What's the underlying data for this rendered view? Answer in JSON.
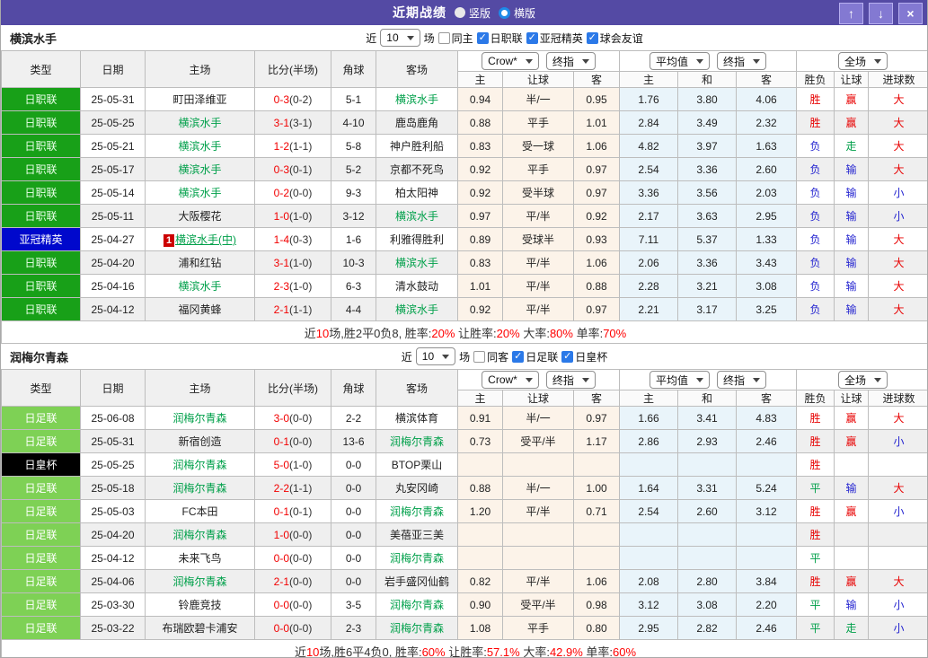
{
  "titlebar": {
    "title": "近期战绩",
    "radio_vertical": "竖版",
    "radio_horizontal": "横版",
    "up_icon": "↑",
    "down_icon": "↓",
    "close_icon": "×"
  },
  "colors": {
    "titlebar_purple": "#544aa4",
    "badge_green": "#18a018",
    "badge_lightgreen": "#7ed155",
    "badge_blue": "#0008cc",
    "badge_black": "#000000",
    "team_green": "#00a04a",
    "score_red": "#f20000",
    "win_red": "#e80000",
    "draw_green": "#00a04a",
    "lose_blue": "#2424d0",
    "handicap_odds_bg": "#fcf3e9",
    "average_odds_bg": "#e9f4fa",
    "checkbox_blue": "#2b79e8"
  },
  "sections": [
    {
      "team": "横滨水手",
      "filter": {
        "near_label": "近",
        "games_value": "10",
        "games_label": "场",
        "checkboxes": [
          {
            "label": "同主",
            "checked": false
          },
          {
            "label": "日职联",
            "checked": true
          },
          {
            "label": "亚冠精英",
            "checked": true
          },
          {
            "label": "球会友谊",
            "checked": true
          }
        ]
      },
      "header": {
        "cols": [
          "类型",
          "日期",
          "主场",
          "比分(半场)",
          "角球",
          "客场"
        ],
        "dropdowns": [
          "Crow*",
          "终指",
          "平均值",
          "终指",
          "全场"
        ],
        "sub_cols": [
          "主",
          "让球",
          "客",
          "主",
          "和",
          "客",
          "胜负",
          "让球",
          "进球数"
        ]
      },
      "rows": [
        {
          "type": "日职联",
          "badge": "green",
          "date": "25-05-31",
          "home": "町田泽维亚",
          "homeTeam": false,
          "score": "0-3",
          "half": "0-2",
          "corner": "5-1",
          "away": "横滨水手",
          "awayTeam": true,
          "odds": [
            "0.94",
            "半/一",
            "0.95",
            "1.76",
            "3.80",
            "4.06"
          ],
          "res": [
            "胜",
            "赢",
            "大"
          ]
        },
        {
          "type": "日职联",
          "badge": "green",
          "date": "25-05-25",
          "home": "横滨水手",
          "homeTeam": true,
          "score": "3-1",
          "half": "3-1",
          "corner": "4-10",
          "away": "鹿岛鹿角",
          "awayTeam": false,
          "odds": [
            "0.88",
            "平手",
            "1.01",
            "2.84",
            "3.49",
            "2.32"
          ],
          "res": [
            "胜",
            "赢",
            "大"
          ]
        },
        {
          "type": "日职联",
          "badge": "green",
          "date": "25-05-21",
          "home": "横滨水手",
          "homeTeam": true,
          "score": "1-2",
          "half": "1-1",
          "corner": "5-8",
          "away": "神户胜利船",
          "awayTeam": false,
          "odds": [
            "0.83",
            "受一球",
            "1.06",
            "4.82",
            "3.97",
            "1.63"
          ],
          "res": [
            "负",
            "走",
            "大"
          ]
        },
        {
          "type": "日职联",
          "badge": "green",
          "date": "25-05-17",
          "home": "横滨水手",
          "homeTeam": true,
          "score": "0-3",
          "half": "0-1",
          "corner": "5-2",
          "away": "京都不死鸟",
          "awayTeam": false,
          "odds": [
            "0.92",
            "平手",
            "0.97",
            "2.54",
            "3.36",
            "2.60"
          ],
          "res": [
            "负",
            "输",
            "大"
          ]
        },
        {
          "type": "日职联",
          "badge": "green",
          "date": "25-05-14",
          "home": "横滨水手",
          "homeTeam": true,
          "score": "0-2",
          "half": "0-0",
          "corner": "9-3",
          "away": "柏太阳神",
          "awayTeam": false,
          "odds": [
            "0.92",
            "受半球",
            "0.97",
            "3.36",
            "3.56",
            "2.03"
          ],
          "res": [
            "负",
            "输",
            "小"
          ]
        },
        {
          "type": "日职联",
          "badge": "green",
          "date": "25-05-11",
          "home": "大阪樱花",
          "homeTeam": false,
          "score": "1-0",
          "half": "1-0",
          "corner": "3-12",
          "away": "横滨水手",
          "awayTeam": true,
          "odds": [
            "0.97",
            "平/半",
            "0.92",
            "2.17",
            "3.63",
            "2.95"
          ],
          "res": [
            "负",
            "输",
            "小"
          ]
        },
        {
          "type": "亚冠精英",
          "badge": "blue",
          "date": "25-04-27",
          "home": "横滨水手(中)",
          "homeTeam": true,
          "mark": "1",
          "score": "1-4",
          "half": "0-3",
          "corner": "1-6",
          "away": "利雅得胜利",
          "awayTeam": false,
          "odds": [
            "0.89",
            "受球半",
            "0.93",
            "7.11",
            "5.37",
            "1.33"
          ],
          "res": [
            "负",
            "输",
            "大"
          ]
        },
        {
          "type": "日职联",
          "badge": "green",
          "date": "25-04-20",
          "home": "浦和红钻",
          "homeTeam": false,
          "score": "3-1",
          "half": "1-0",
          "corner": "10-3",
          "away": "横滨水手",
          "awayTeam": true,
          "odds": [
            "0.83",
            "平/半",
            "1.06",
            "2.06",
            "3.36",
            "3.43"
          ],
          "res": [
            "负",
            "输",
            "大"
          ]
        },
        {
          "type": "日职联",
          "badge": "green",
          "date": "25-04-16",
          "home": "横滨水手",
          "homeTeam": true,
          "score": "2-3",
          "half": "1-0",
          "corner": "6-3",
          "away": "清水鼓动",
          "awayTeam": false,
          "odds": [
            "1.01",
            "平/半",
            "0.88",
            "2.28",
            "3.21",
            "3.08"
          ],
          "res": [
            "负",
            "输",
            "大"
          ]
        },
        {
          "type": "日职联",
          "badge": "green",
          "date": "25-04-12",
          "home": "福冈黄蜂",
          "homeTeam": false,
          "score": "2-1",
          "half": "1-1",
          "corner": "4-4",
          "away": "横滨水手",
          "awayTeam": true,
          "odds": [
            "0.92",
            "平/半",
            "0.97",
            "2.21",
            "3.17",
            "3.25"
          ],
          "res": [
            "负",
            "输",
            "大"
          ]
        }
      ],
      "summary": [
        {
          "text": "近",
          "red": false
        },
        {
          "text": "10",
          "red": true
        },
        {
          "text": "场,胜2平0负8, 胜率:",
          "red": false
        },
        {
          "text": "20%",
          "red": true
        },
        {
          "text": " 让胜率:",
          "red": false
        },
        {
          "text": "20%",
          "red": true
        },
        {
          "text": " 大率:",
          "red": false
        },
        {
          "text": "80%",
          "red": true
        },
        {
          "text": " 单率:",
          "red": false
        },
        {
          "text": "70%",
          "red": true
        }
      ]
    },
    {
      "team": "润梅尔青森",
      "filter": {
        "near_label": "近",
        "games_value": "10",
        "games_label": "场",
        "checkboxes": [
          {
            "label": "同客",
            "checked": false
          },
          {
            "label": "日足联",
            "checked": true
          },
          {
            "label": "日皇杯",
            "checked": true
          }
        ]
      },
      "header": {
        "cols": [
          "类型",
          "日期",
          "主场",
          "比分(半场)",
          "角球",
          "客场"
        ],
        "dropdowns": [
          "Crow*",
          "终指",
          "平均值",
          "终指",
          "全场"
        ],
        "sub_cols": [
          "主",
          "让球",
          "客",
          "主",
          "和",
          "客",
          "胜负",
          "让球",
          "进球数"
        ]
      },
      "rows": [
        {
          "type": "日足联",
          "badge": "lightgreen",
          "date": "25-06-08",
          "home": "润梅尔青森",
          "homeTeam": true,
          "score": "3-0",
          "half": "0-0",
          "corner": "2-2",
          "away": "横滨体育",
          "awayTeam": false,
          "odds": [
            "0.91",
            "半/一",
            "0.97",
            "1.66",
            "3.41",
            "4.83"
          ],
          "res": [
            "胜",
            "赢",
            "大"
          ]
        },
        {
          "type": "日足联",
          "badge": "lightgreen",
          "date": "25-05-31",
          "home": "新宿创造",
          "homeTeam": false,
          "score": "0-1",
          "half": "0-0",
          "corner": "13-6",
          "away": "润梅尔青森",
          "awayTeam": true,
          "odds": [
            "0.73",
            "受平/半",
            "1.17",
            "2.86",
            "2.93",
            "2.46"
          ],
          "res": [
            "胜",
            "赢",
            "小"
          ]
        },
        {
          "type": "日皇杯",
          "badge": "black",
          "date": "25-05-25",
          "home": "润梅尔青森",
          "homeTeam": true,
          "score": "5-0",
          "half": "1-0",
          "corner": "0-0",
          "away": "BTOP栗山",
          "awayTeam": false,
          "odds": [
            "",
            "",
            "",
            "",
            "",
            ""
          ],
          "res": [
            "胜",
            "",
            ""
          ]
        },
        {
          "type": "日足联",
          "badge": "lightgreen",
          "date": "25-05-18",
          "home": "润梅尔青森",
          "homeTeam": true,
          "score": "2-2",
          "half": "1-1",
          "corner": "0-0",
          "away": "丸安冈崎",
          "awayTeam": false,
          "odds": [
            "0.88",
            "半/一",
            "1.00",
            "1.64",
            "3.31",
            "5.24"
          ],
          "res": [
            "平",
            "输",
            "大"
          ]
        },
        {
          "type": "日足联",
          "badge": "lightgreen",
          "date": "25-05-03",
          "home": "FC本田",
          "homeTeam": false,
          "score": "0-1",
          "half": "0-1",
          "corner": "0-0",
          "away": "润梅尔青森",
          "awayTeam": true,
          "odds": [
            "1.20",
            "平/半",
            "0.71",
            "2.54",
            "2.60",
            "3.12"
          ],
          "res": [
            "胜",
            "赢",
            "小"
          ]
        },
        {
          "type": "日足联",
          "badge": "lightgreen",
          "date": "25-04-20",
          "home": "润梅尔青森",
          "homeTeam": true,
          "score": "1-0",
          "half": "0-0",
          "corner": "0-0",
          "away": "美蓓亚三美",
          "awayTeam": false,
          "odds": [
            "",
            "",
            "",
            "",
            "",
            ""
          ],
          "res": [
            "胜",
            "",
            ""
          ]
        },
        {
          "type": "日足联",
          "badge": "lightgreen",
          "date": "25-04-12",
          "home": "未来飞鸟",
          "homeTeam": false,
          "score": "0-0",
          "half": "0-0",
          "corner": "0-0",
          "away": "润梅尔青森",
          "awayTeam": true,
          "odds": [
            "",
            "",
            "",
            "",
            "",
            ""
          ],
          "res": [
            "平",
            "",
            ""
          ]
        },
        {
          "type": "日足联",
          "badge": "lightgreen",
          "date": "25-04-06",
          "home": "润梅尔青森",
          "homeTeam": true,
          "score": "2-1",
          "half": "0-0",
          "corner": "0-0",
          "away": "岩手盛冈仙鹤",
          "awayTeam": false,
          "odds": [
            "0.82",
            "平/半",
            "1.06",
            "2.08",
            "2.80",
            "3.84"
          ],
          "res": [
            "胜",
            "赢",
            "大"
          ]
        },
        {
          "type": "日足联",
          "badge": "lightgreen",
          "date": "25-03-30",
          "home": "铃鹿竞技",
          "homeTeam": false,
          "score": "0-0",
          "half": "0-0",
          "corner": "3-5",
          "away": "润梅尔青森",
          "awayTeam": true,
          "odds": [
            "0.90",
            "受平/半",
            "0.98",
            "3.12",
            "3.08",
            "2.20"
          ],
          "res": [
            "平",
            "输",
            "小"
          ]
        },
        {
          "type": "日足联",
          "badge": "lightgreen",
          "date": "25-03-22",
          "home": "布瑞欧碧卡浦安",
          "homeTeam": false,
          "score": "0-0",
          "half": "0-0",
          "corner": "2-3",
          "away": "润梅尔青森",
          "awayTeam": true,
          "odds": [
            "1.08",
            "平手",
            "0.80",
            "2.95",
            "2.82",
            "2.46"
          ],
          "res": [
            "平",
            "走",
            "小"
          ]
        }
      ],
      "summary": [
        {
          "text": "近",
          "red": false
        },
        {
          "text": "10",
          "red": true
        },
        {
          "text": "场,胜6平4负0, 胜率:",
          "red": false
        },
        {
          "text": "60%",
          "red": true
        },
        {
          "text": " 让胜率:",
          "red": false
        },
        {
          "text": "57.1%",
          "red": true
        },
        {
          "text": " 大率:",
          "red": false
        },
        {
          "text": "42.9%",
          "red": true
        },
        {
          "text": " 单率:",
          "red": false
        },
        {
          "text": "60%",
          "red": true
        }
      ]
    }
  ]
}
